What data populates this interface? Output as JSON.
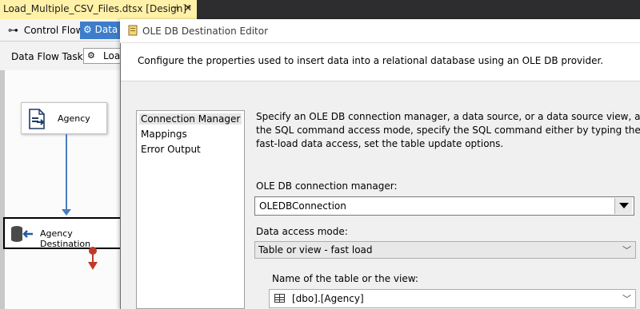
{
  "document_tab": {
    "title": "Load_Multiple_CSV_Files.dtsx [Design]*",
    "pin": "⊣",
    "close": "✕"
  },
  "designer": {
    "tabs": [
      {
        "label": "Control Flow"
      },
      {
        "label": "Data"
      }
    ],
    "data_flow_task_label": "Data Flow Task:",
    "data_flow_task_value": "Load"
  },
  "surface": {
    "source_component": "Agency",
    "destination_component": "Agency Destination"
  },
  "editor": {
    "title": "OLE DB Destination Editor",
    "description": "Configure the properties used to insert data into a relational database using an OLE DB provider.",
    "nav": [
      "Connection Manager",
      "Mappings",
      "Error Output"
    ],
    "intro": [
      "Specify an OLE DB connection manager, a data source, or a data source view, and select the da",
      "the SQL command access mode, specify the SQL command either by typing the query or by u",
      "fast-load data access, set the table update options."
    ],
    "connection_manager_label": "OLE DB connection manager:",
    "connection_manager_value": "OLEDBConnection",
    "access_mode_label": "Data access mode:",
    "access_mode_value": "Table or view - fast load",
    "table_label": "Name of the table or the view:",
    "table_value": "[dbo].[Agency]"
  },
  "colors": {
    "accent": "#3d7dc9",
    "tab_highlight": "#fff1a8",
    "connector": "#4b7bbf",
    "error_path": "#c0392b"
  }
}
